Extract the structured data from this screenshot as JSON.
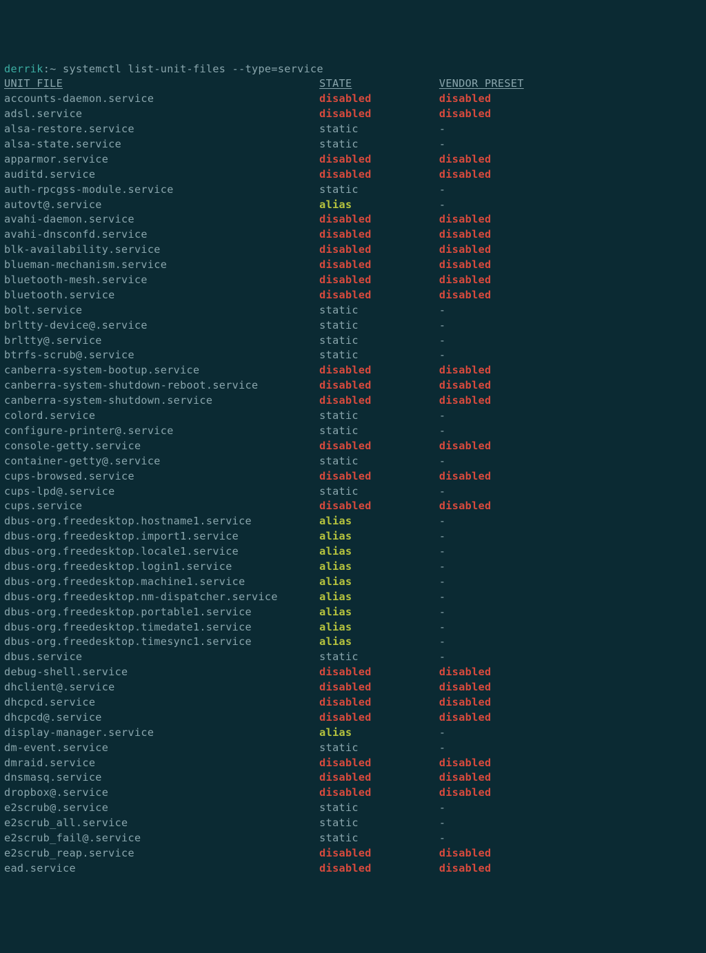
{
  "prompt": {
    "user": "derrik",
    "path": ":~",
    "symbol": " "
  },
  "command": "systemctl list-unit-files --type=service",
  "headers": {
    "unit": "UNIT FILE",
    "state": "STATE",
    "preset": "VENDOR PRESET"
  },
  "rows": [
    {
      "unit": "accounts-daemon.service",
      "state": "disabled",
      "preset": "disabled"
    },
    {
      "unit": "adsl.service",
      "state": "disabled",
      "preset": "disabled"
    },
    {
      "unit": "alsa-restore.service",
      "state": "static",
      "preset": "-"
    },
    {
      "unit": "alsa-state.service",
      "state": "static",
      "preset": "-"
    },
    {
      "unit": "apparmor.service",
      "state": "disabled",
      "preset": "disabled"
    },
    {
      "unit": "auditd.service",
      "state": "disabled",
      "preset": "disabled"
    },
    {
      "unit": "auth-rpcgss-module.service",
      "state": "static",
      "preset": "-"
    },
    {
      "unit": "autovt@.service",
      "state": "alias",
      "preset": "-"
    },
    {
      "unit": "avahi-daemon.service",
      "state": "disabled",
      "preset": "disabled"
    },
    {
      "unit": "avahi-dnsconfd.service",
      "state": "disabled",
      "preset": "disabled"
    },
    {
      "unit": "blk-availability.service",
      "state": "disabled",
      "preset": "disabled"
    },
    {
      "unit": "blueman-mechanism.service",
      "state": "disabled",
      "preset": "disabled"
    },
    {
      "unit": "bluetooth-mesh.service",
      "state": "disabled",
      "preset": "disabled"
    },
    {
      "unit": "bluetooth.service",
      "state": "disabled",
      "preset": "disabled"
    },
    {
      "unit": "bolt.service",
      "state": "static",
      "preset": "-"
    },
    {
      "unit": "brltty-device@.service",
      "state": "static",
      "preset": "-"
    },
    {
      "unit": "brltty@.service",
      "state": "static",
      "preset": "-"
    },
    {
      "unit": "btrfs-scrub@.service",
      "state": "static",
      "preset": "-"
    },
    {
      "unit": "canberra-system-bootup.service",
      "state": "disabled",
      "preset": "disabled"
    },
    {
      "unit": "canberra-system-shutdown-reboot.service",
      "state": "disabled",
      "preset": "disabled"
    },
    {
      "unit": "canberra-system-shutdown.service",
      "state": "disabled",
      "preset": "disabled"
    },
    {
      "unit": "colord.service",
      "state": "static",
      "preset": "-"
    },
    {
      "unit": "configure-printer@.service",
      "state": "static",
      "preset": "-"
    },
    {
      "unit": "console-getty.service",
      "state": "disabled",
      "preset": "disabled"
    },
    {
      "unit": "container-getty@.service",
      "state": "static",
      "preset": "-"
    },
    {
      "unit": "cups-browsed.service",
      "state": "disabled",
      "preset": "disabled"
    },
    {
      "unit": "cups-lpd@.service",
      "state": "static",
      "preset": "-"
    },
    {
      "unit": "cups.service",
      "state": "disabled",
      "preset": "disabled"
    },
    {
      "unit": "dbus-org.freedesktop.hostname1.service",
      "state": "alias",
      "preset": "-"
    },
    {
      "unit": "dbus-org.freedesktop.import1.service",
      "state": "alias",
      "preset": "-"
    },
    {
      "unit": "dbus-org.freedesktop.locale1.service",
      "state": "alias",
      "preset": "-"
    },
    {
      "unit": "dbus-org.freedesktop.login1.service",
      "state": "alias",
      "preset": "-"
    },
    {
      "unit": "dbus-org.freedesktop.machine1.service",
      "state": "alias",
      "preset": "-"
    },
    {
      "unit": "dbus-org.freedesktop.nm-dispatcher.service",
      "state": "alias",
      "preset": "-"
    },
    {
      "unit": "dbus-org.freedesktop.portable1.service",
      "state": "alias",
      "preset": "-"
    },
    {
      "unit": "dbus-org.freedesktop.timedate1.service",
      "state": "alias",
      "preset": "-"
    },
    {
      "unit": "dbus-org.freedesktop.timesync1.service",
      "state": "alias",
      "preset": "-"
    },
    {
      "unit": "dbus.service",
      "state": "static",
      "preset": "-"
    },
    {
      "unit": "debug-shell.service",
      "state": "disabled",
      "preset": "disabled"
    },
    {
      "unit": "dhclient@.service",
      "state": "disabled",
      "preset": "disabled"
    },
    {
      "unit": "dhcpcd.service",
      "state": "disabled",
      "preset": "disabled"
    },
    {
      "unit": "dhcpcd@.service",
      "state": "disabled",
      "preset": "disabled"
    },
    {
      "unit": "display-manager.service",
      "state": "alias",
      "preset": "-"
    },
    {
      "unit": "dm-event.service",
      "state": "static",
      "preset": "-"
    },
    {
      "unit": "dmraid.service",
      "state": "disabled",
      "preset": "disabled"
    },
    {
      "unit": "dnsmasq.service",
      "state": "disabled",
      "preset": "disabled"
    },
    {
      "unit": "dropbox@.service",
      "state": "disabled",
      "preset": "disabled"
    },
    {
      "unit": "e2scrub@.service",
      "state": "static",
      "preset": "-"
    },
    {
      "unit": "e2scrub_all.service",
      "state": "static",
      "preset": "-"
    },
    {
      "unit": "e2scrub_fail@.service",
      "state": "static",
      "preset": "-"
    },
    {
      "unit": "e2scrub_reap.service",
      "state": "disabled",
      "preset": "disabled"
    },
    {
      "unit": "ead.service",
      "state": "disabled",
      "preset": "disabled"
    }
  ]
}
